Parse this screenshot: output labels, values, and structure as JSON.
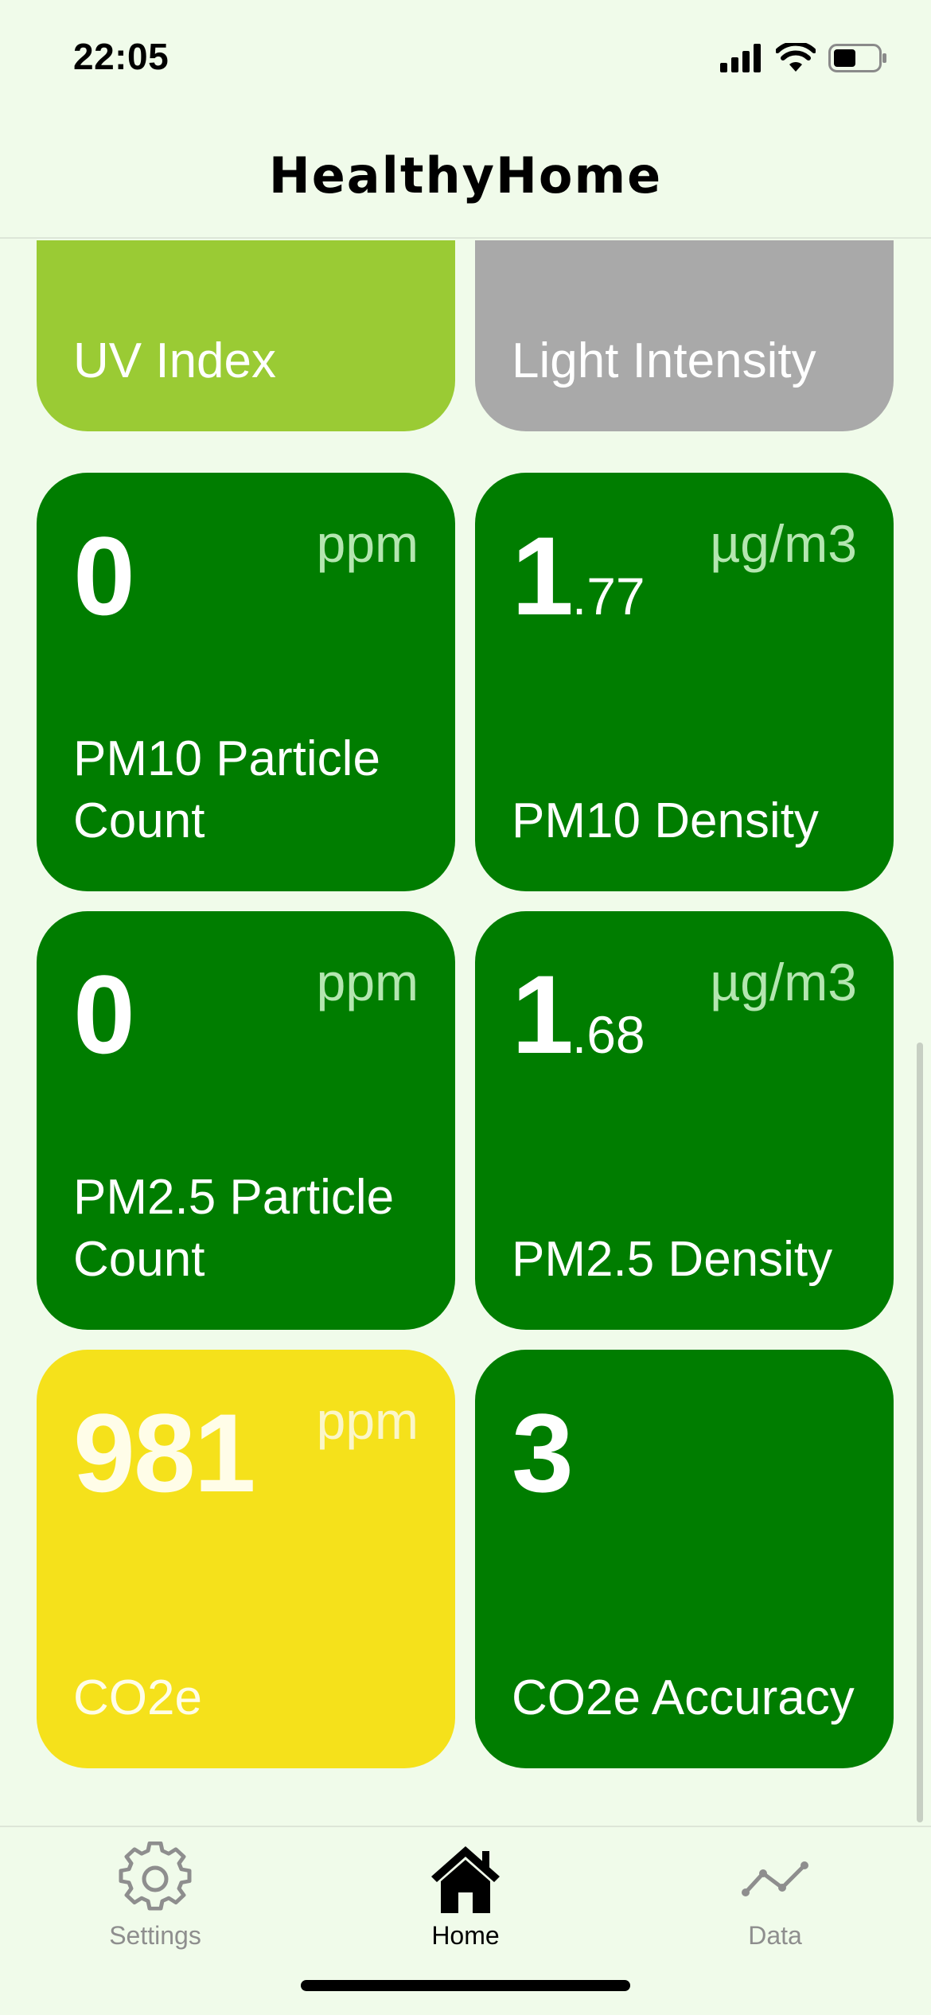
{
  "status_bar": {
    "time": "22:05",
    "icons": [
      "cellular-signal-icon",
      "wifi-icon",
      "battery-icon"
    ],
    "battery_level": 0.5
  },
  "nav": {
    "title": "HealthyHome"
  },
  "tiles": [
    {
      "label": "UV Index",
      "value": "",
      "decimal": "",
      "unit": "",
      "color": "#9acb34"
    },
    {
      "label": "Light Intensity",
      "value": "",
      "decimal": "",
      "unit": "",
      "color": "#a9a9a9"
    },
    {
      "label": "PM10 Particle Count",
      "value": "0",
      "decimal": "",
      "unit": "ppm",
      "color": "#007d00"
    },
    {
      "label": "PM10 Density",
      "value": "1",
      "decimal": ".77",
      "unit": "µg/m3",
      "color": "#007d00"
    },
    {
      "label": "PM2.5 Particle Count",
      "value": "0",
      "decimal": "",
      "unit": "ppm",
      "color": "#007d00"
    },
    {
      "label": "PM2.5 Density",
      "value": "1",
      "decimal": ".68",
      "unit": "µg/m3",
      "color": "#007d00"
    },
    {
      "label": "CO2e",
      "value": "981",
      "decimal": "",
      "unit": "ppm",
      "color": "#f5e11b"
    },
    {
      "label": "CO2e Accuracy",
      "value": "3",
      "decimal": "",
      "unit": "",
      "color": "#007d00"
    }
  ],
  "tab_bar": {
    "items": [
      {
        "label": "Settings",
        "icon": "gear-icon",
        "active": false
      },
      {
        "label": "Home",
        "icon": "house-icon",
        "active": true
      },
      {
        "label": "Data",
        "icon": "line-chart-icon",
        "active": false
      }
    ]
  },
  "colors": {
    "background": "#f0fbea",
    "good": "#007d00",
    "moderate": "#f5e11b",
    "uv": "#9acb34",
    "neutral": "#a9a9a9",
    "tab_inactive": "#8e8e8e",
    "tab_active": "#000000"
  }
}
